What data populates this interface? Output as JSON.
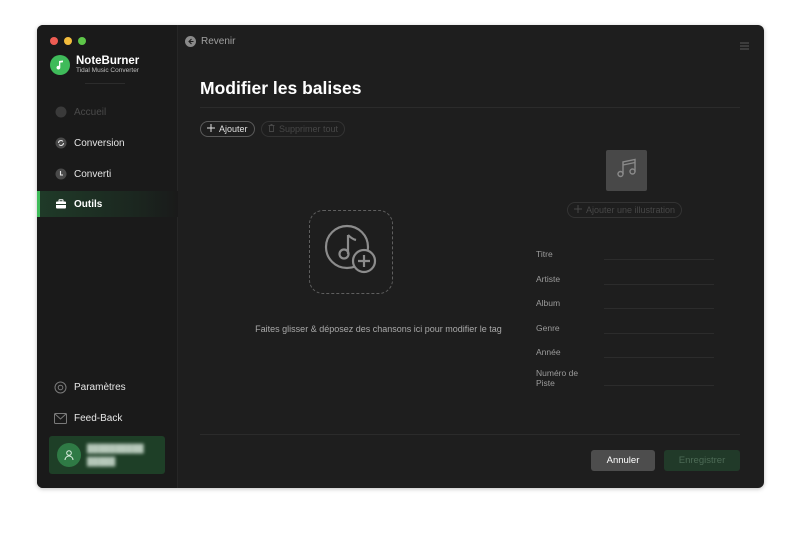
{
  "app": {
    "name": "NoteBurner",
    "subtitle": "Tidal Music Converter"
  },
  "sidebar": {
    "items": [
      {
        "label": "Accueil",
        "icon": "home-icon",
        "state": "disabled"
      },
      {
        "label": "Conversion",
        "icon": "convert-icon",
        "state": "normal"
      },
      {
        "label": "Converti",
        "icon": "clock-icon",
        "state": "normal"
      },
      {
        "label": "Outils",
        "icon": "toolbox-icon",
        "state": "active"
      }
    ],
    "bottom_items": [
      {
        "label": "Paramètres",
        "icon": "gear-icon"
      },
      {
        "label": "Feed-Back",
        "icon": "mail-icon"
      }
    ],
    "user": {
      "line1": "██████████",
      "line2": "█████"
    }
  },
  "header": {
    "back_label": "Revenir"
  },
  "page": {
    "title": "Modifier les balises",
    "add_label": "Ajouter",
    "delete_all_label": "Supprimer tout",
    "drop_text": "Faites glisser & déposez des chansons ici pour modifier le tag",
    "add_art_label": "Ajouter une illustration"
  },
  "fields": [
    {
      "label": "Titre",
      "value": ""
    },
    {
      "label": "Artiste",
      "value": ""
    },
    {
      "label": "Album",
      "value": ""
    },
    {
      "label": "Genre",
      "value": ""
    },
    {
      "label": "Année",
      "value": ""
    },
    {
      "label": "Numéro de Piste",
      "value": ""
    }
  ],
  "footer": {
    "cancel_label": "Annuler",
    "save_label": "Enregistrer"
  },
  "colors": {
    "accent": "#3fbb5a",
    "background": "#1e1e1e",
    "sidebar": "#1a1a1a"
  }
}
